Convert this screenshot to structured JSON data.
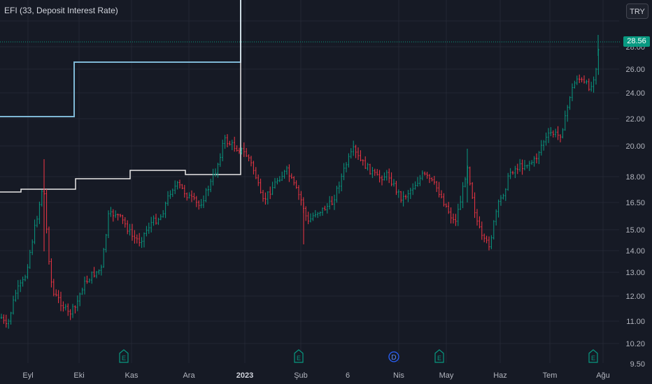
{
  "header": {
    "legend": "EFI (33, Deposit Interest Rate)",
    "currency_button": "TRY"
  },
  "price_axis": {
    "current_price": "28.56",
    "labels": [
      "28.00",
      "26.00",
      "24.00",
      "22.00",
      "20.00",
      "18.00",
      "16.50",
      "15.00",
      "14.00",
      "13.00",
      "12.00",
      "11.00",
      "10.20",
      "9.50"
    ]
  },
  "time_axis": {
    "labels": [
      "Eyl",
      "Eki",
      "Kas",
      "Ara",
      "2023",
      "Şub",
      "6",
      "Nis",
      "May",
      "Haz",
      "Tem",
      "Ağu"
    ]
  },
  "events": [
    {
      "type": "earnings",
      "label": "E"
    },
    {
      "type": "earnings",
      "label": "E"
    },
    {
      "type": "dividend",
      "label": "D"
    },
    {
      "type": "earnings",
      "label": "E"
    },
    {
      "type": "earnings",
      "label": "E"
    }
  ],
  "colors": {
    "background": "#161a25",
    "grid": "#232733",
    "up": "#089981",
    "down": "#f23645",
    "rate_line_blue": "#7fb8d6",
    "rate_line_white": "#e8e8e8",
    "text": "#b2b5be"
  }
}
